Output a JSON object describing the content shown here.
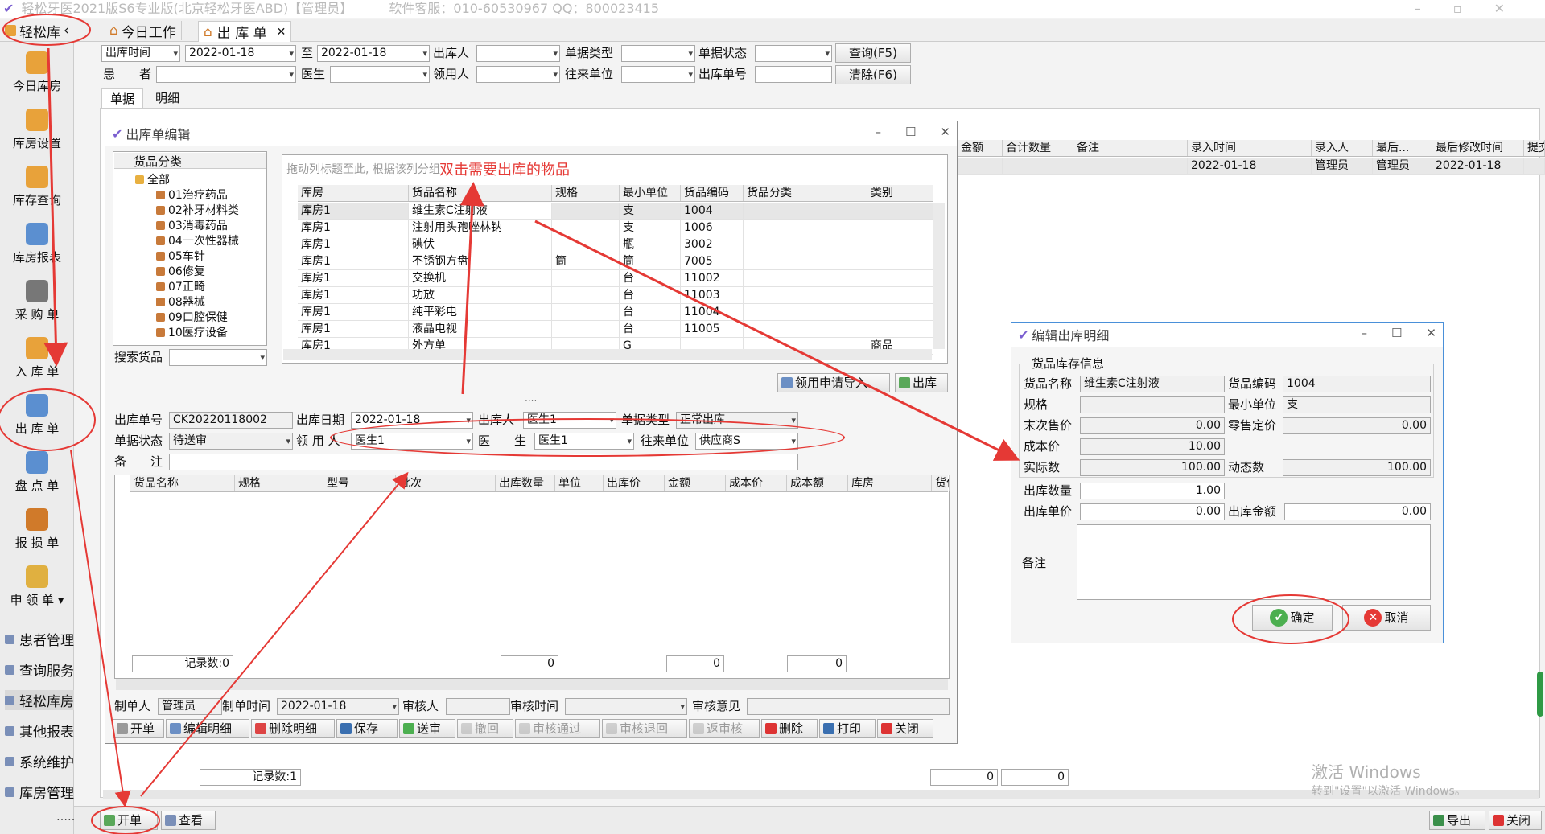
{
  "app": {
    "title": "轻松牙医2021版S6专业版(北京轻松牙医ABD)【管理员】",
    "service": "软件客服：010-60530967  QQ：800023415"
  },
  "tabs": {
    "module": "轻松库",
    "today": "今日工作",
    "outbound": "出 库 单"
  },
  "sidebar": {
    "items": [
      "今日库房",
      "库房设置",
      "库存查询",
      "库房报表",
      "采 购 单",
      "入 库 单",
      "出 库 单",
      "盘 点 单",
      "报 损 单",
      "申 领 单 ▾"
    ],
    "menus": [
      "患者管理",
      "查询服务",
      "轻松库房",
      "其他报表",
      "系统维护",
      "库房管理"
    ],
    "more": "……"
  },
  "filter": {
    "date_field": "出库时间",
    "date_from": "2022-01-18",
    "to": "至",
    "date_to": "2022-01-18",
    "out_person": "出库人",
    "doc_type": "单据类型",
    "doc_status": "单据状态",
    "query": "查询(F5)",
    "patient": "患　　者",
    "doctor": "医生",
    "recipient": "领用人",
    "partner": "往来单位",
    "doc_no": "出库单号",
    "clear": "清除(F6)"
  },
  "subtabs": [
    "单据",
    "明细"
  ],
  "main_grid": {
    "headers": [
      "金额",
      "合计数量",
      "备注",
      "录入时间",
      "录入人",
      "最后...",
      "最后修改时间",
      "提交"
    ],
    "row": [
      "",
      "",
      "",
      "2022-01-18",
      "管理员",
      "管理员",
      "2022-01-18",
      ""
    ],
    "count": "记录数:1",
    "sum1": "0",
    "sum2": "0"
  },
  "bottom": {
    "open": "开单",
    "view": "查看",
    "export": "导出",
    "close": "关闭"
  },
  "editor": {
    "title": "出库单编辑",
    "category_header": "货品分类",
    "categories": [
      "全部",
      "01治疗药品",
      "02补牙材料类",
      "03消毒药品",
      "04一次性器械",
      "05车针",
      "06修复",
      "07正畸",
      "08器械",
      "09口腔保健",
      "10医疗设备"
    ],
    "search_label": "搜索货品",
    "drag_hint": "拖动列标题至此, 根据该列分组",
    "annotation_double": "双击需要出库的物品",
    "goods_headers": [
      "库房",
      "货品名称",
      "规格",
      "最小单位",
      "货品编码",
      "货品分类",
      "类别"
    ],
    "goods": [
      [
        "库房1",
        "维生素C注射液",
        "",
        "支",
        "1004",
        "",
        ""
      ],
      [
        "库房1",
        "注射用头孢唑林钠",
        "",
        "支",
        "1006",
        "",
        ""
      ],
      [
        "库房1",
        "碘伏",
        "",
        "瓶",
        "3002",
        "",
        ""
      ],
      [
        "库房1",
        "不锈钢方盘",
        "筒",
        "筒",
        "7005",
        "",
        ""
      ],
      [
        "库房1",
        "交换机",
        "",
        "台",
        "11002",
        "",
        ""
      ],
      [
        "库房1",
        "功放",
        "",
        "台",
        "11003",
        "",
        ""
      ],
      [
        "库房1",
        "纯平彩电",
        "",
        "台",
        "11004",
        "",
        ""
      ],
      [
        "库房1",
        "液晶电视",
        "",
        "台",
        "11005",
        "",
        ""
      ],
      [
        "库房1",
        "外方单",
        "",
        "G",
        "",
        "",
        "商品"
      ]
    ],
    "import_btn": "领用申请导入",
    "out_btn": "出库",
    "dots": "....",
    "doc": {
      "no_label": "出库单号",
      "no": "CK20220118002",
      "date_label": "出库日期",
      "date": "2022-01-18",
      "person_label": "出库人",
      "person": "医生1",
      "type_label": "单据类型",
      "type": "正常出库",
      "status_label": "单据状态",
      "status": "待送审",
      "recipient_label": "领 用 人",
      "recipient": "医生1",
      "doctor_label": "医　　生",
      "doctor": "医生1",
      "partner_label": "往来单位",
      "partner": "供应商S",
      "remark_label": "备　　注"
    },
    "detail_headers": [
      "货品名称",
      "规格",
      "型号",
      "批次",
      "出库数量",
      "单位",
      "出库价",
      "金额",
      "成本价",
      "成本额",
      "库房",
      "货位"
    ],
    "detail_count": "记录数:0",
    "totals": [
      "0",
      "0",
      "0"
    ],
    "footer": {
      "maker_label": "制单人",
      "maker": "管理员",
      "make_time_label": "制单时间",
      "make_time": "2022-01-18",
      "auditor_label": "审核人",
      "audit_time_label": "审核时间",
      "opinion_label": "审核意见"
    },
    "actions": [
      "开单",
      "编辑明细",
      "删除明细",
      "保存",
      "送审",
      "撤回",
      "审核通过",
      "审核退回",
      "返审核",
      "删除",
      "打印",
      "关闭"
    ]
  },
  "dialog": {
    "title": "编辑出库明细",
    "group": "货品库存信息",
    "name_label": "货品名称",
    "name": "维生素C注射液",
    "code_label": "货品编码",
    "code": "1004",
    "spec_label": "规格",
    "unit_label": "最小单位",
    "unit": "支",
    "last_price_label": "末次售价",
    "last_price": "0.00",
    "retail_label": "零售定价",
    "retail": "0.00",
    "cost_label": "成本价",
    "cost": "10.00",
    "actual_label": "实际数",
    "actual": "100.00",
    "dynamic_label": "动态数",
    "dynamic": "100.00",
    "qty_label": "出库数量",
    "qty": "1.00",
    "unit_price_label": "出库单价",
    "unit_price": "0.00",
    "amount_label": "出库金额",
    "amount": "0.00",
    "remark_label": "备注",
    "ok": "确定",
    "cancel": "取消"
  },
  "watermark": {
    "line1": "激活 Windows",
    "line2": "转到\"设置\"以激活 Windows。"
  },
  "colors": {
    "accent": "#e53935",
    "window_bg": "#f5f5f5"
  }
}
